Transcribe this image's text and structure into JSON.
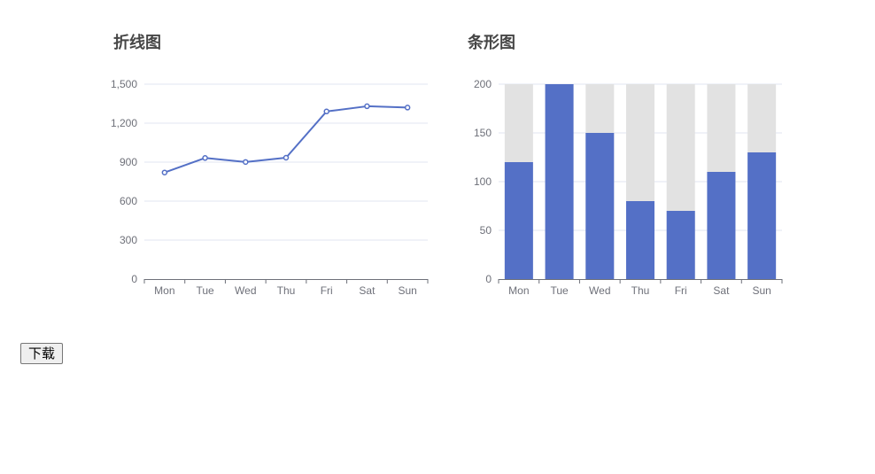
{
  "chart_data": [
    {
      "type": "line",
      "title": "折线图",
      "xlabel": "",
      "ylabel": "",
      "categories": [
        "Mon",
        "Tue",
        "Wed",
        "Thu",
        "Fri",
        "Sat",
        "Sun"
      ],
      "values": [
        820,
        932,
        901,
        934,
        1290,
        1330,
        1320
      ],
      "ylim": [
        0,
        1500
      ],
      "yticks": [
        "0",
        "300",
        "600",
        "900",
        "1,200",
        "1,500"
      ],
      "grid": true,
      "color": "#5470c6"
    },
    {
      "type": "bar",
      "title": "条形图",
      "xlabel": "",
      "ylabel": "",
      "categories": [
        "Mon",
        "Tue",
        "Wed",
        "Thu",
        "Fri",
        "Sat",
        "Sun"
      ],
      "values": [
        120,
        200,
        150,
        80,
        70,
        110,
        130
      ],
      "background_max": 200,
      "ylim": [
        0,
        200
      ],
      "yticks": [
        "0",
        "50",
        "100",
        "150",
        "200"
      ],
      "grid": true,
      "color": "#5470c6",
      "background_color": "#e2e2e2"
    }
  ],
  "toolbar": {
    "download_label": "下载"
  }
}
